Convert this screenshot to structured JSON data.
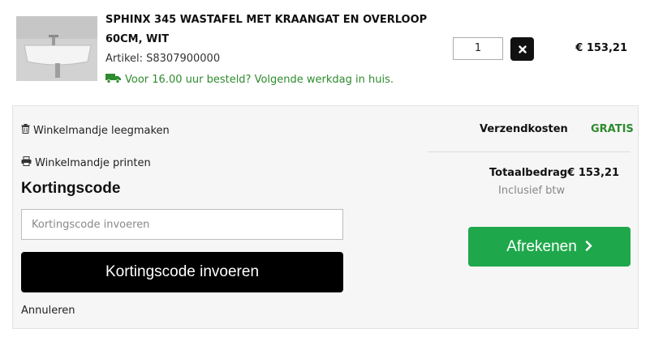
{
  "product": {
    "name": "SPHINX 345 WASTAFEL MET KRAANGAT EN OVERLOOP 60CM, WIT",
    "sku": "Artikel: S8307900000",
    "delivery": "Voor 16.00 uur besteld? Volgende werkdag in huis.",
    "quantity": "1",
    "price": "€ 153,21"
  },
  "cart_actions": {
    "empty_cart": "Winkelmandje leegmaken",
    "print_cart": "Winkelmandje printen"
  },
  "discount": {
    "heading": "Kortingscode",
    "placeholder": "Kortingscode invoeren",
    "button_label": "Kortingscode invoeren",
    "cancel": "Annuleren"
  },
  "summary": {
    "shipping_label": "Verzendkosten",
    "shipping_value": "GRATIS",
    "total_label": "Totaalbedrag",
    "total_value": "€ 153,21",
    "vat_note": "Inclusief btw",
    "checkout_label": "Afrekenen"
  },
  "colors": {
    "green": "#1ea84b",
    "delivery_green": "#2e8b2e",
    "button_dark": "#000000"
  }
}
